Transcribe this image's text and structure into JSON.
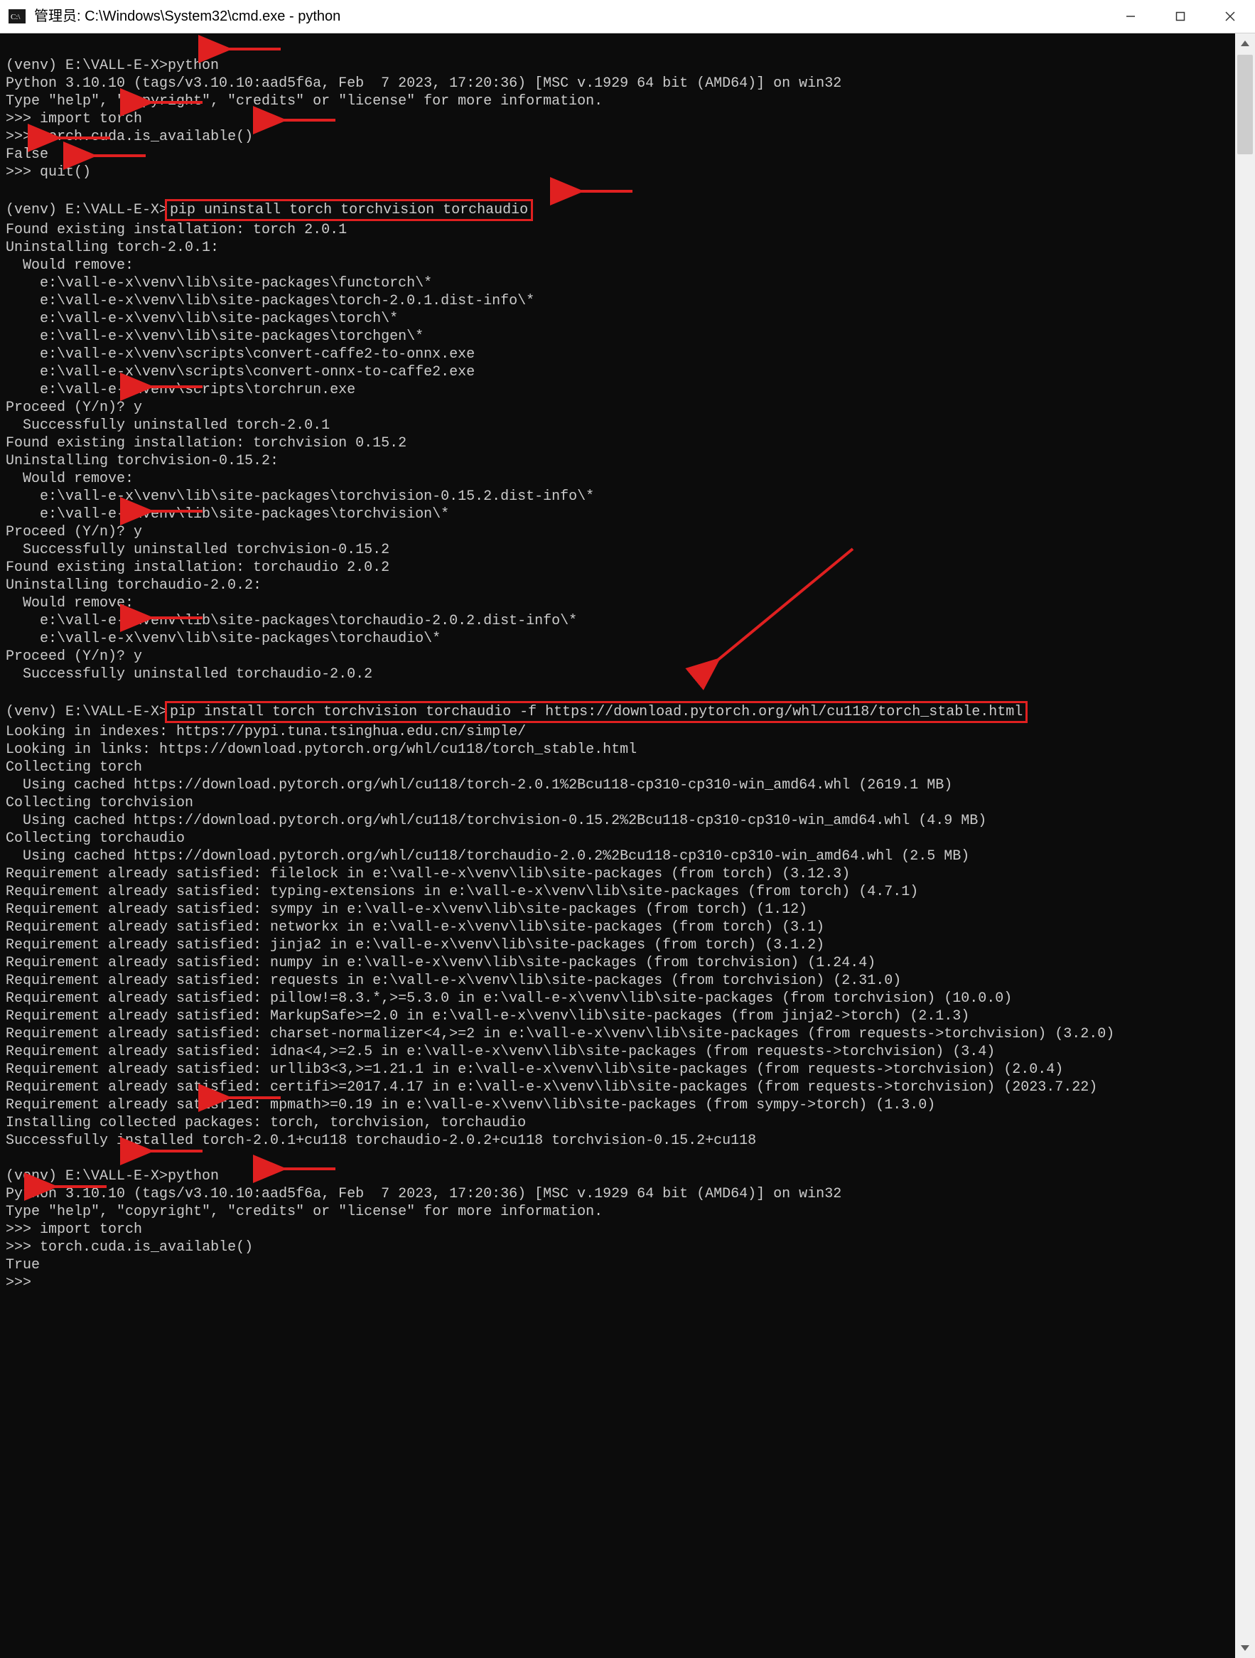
{
  "title": "管理员: C:\\Windows\\System32\\cmd.exe - python",
  "prompt": "(venv) E:\\VALL-E-X>",
  "py_prompt": ">>>",
  "cmd": {
    "python": "python",
    "import_torch": "import torch",
    "cuda_avail": "torch.cuda.is_available()",
    "quit": "quit()",
    "pip_uninstall": "pip uninstall torch torchvision torchaudio",
    "pip_install": "pip install torch torchvision torchaudio -f https://download.pytorch.org/whl/cu118/torch_stable.html"
  },
  "out": {
    "py_version": "Python 3.10.10 (tags/v3.10.10:aad5f6a, Feb  7 2023, 17:20:36) [MSC v.1929 64 bit (AMD64)] on win32",
    "py_hint": "Type \"help\", \"copyright\", \"credits\" or \"license\" for more information.",
    "false": "False",
    "true": "True",
    "found_torch": "Found existing installation: torch 2.0.1",
    "uninst_torch_hdr": "Uninstalling torch-2.0.1:",
    "would_remove": "  Would remove:",
    "rm1": "    e:\\vall-e-x\\venv\\lib\\site-packages\\functorch\\*",
    "rm2": "    e:\\vall-e-x\\venv\\lib\\site-packages\\torch-2.0.1.dist-info\\*",
    "rm3": "    e:\\vall-e-x\\venv\\lib\\site-packages\\torch\\*",
    "rm4": "    e:\\vall-e-x\\venv\\lib\\site-packages\\torchgen\\*",
    "rm5": "    e:\\vall-e-x\\venv\\scripts\\convert-caffe2-to-onnx.exe",
    "rm6": "    e:\\vall-e-x\\venv\\scripts\\convert-onnx-to-caffe2.exe",
    "rm7": "    e:\\vall-e-x\\venv\\scripts\\torchrun.exe",
    "proceed": "Proceed (Y/n)? y",
    "ok_uninst_torch": "  Successfully uninstalled torch-2.0.1",
    "found_tv": "Found existing installation: torchvision 0.15.2",
    "uninst_tv_hdr": "Uninstalling torchvision-0.15.2:",
    "rm_tv1": "    e:\\vall-e-x\\venv\\lib\\site-packages\\torchvision-0.15.2.dist-info\\*",
    "rm_tv2": "    e:\\vall-e-x\\venv\\lib\\site-packages\\torchvision\\*",
    "ok_uninst_tv": "  Successfully uninstalled torchvision-0.15.2",
    "found_ta": "Found existing installation: torchaudio 2.0.2",
    "uninst_ta_hdr": "Uninstalling torchaudio-2.0.2:",
    "rm_ta1": "    e:\\vall-e-x\\venv\\lib\\site-packages\\torchaudio-2.0.2.dist-info\\*",
    "rm_ta2": "    e:\\vall-e-x\\venv\\lib\\site-packages\\torchaudio\\*",
    "ok_uninst_ta": "  Successfully uninstalled torchaudio-2.0.2",
    "look_idx": "Looking in indexes: https://pypi.tuna.tsinghua.edu.cn/simple/",
    "look_links": "Looking in links: https://download.pytorch.org/whl/cu118/torch_stable.html",
    "coll_torch": "Collecting torch",
    "cache_torch": "  Using cached https://download.pytorch.org/whl/cu118/torch-2.0.1%2Bcu118-cp310-cp310-win_amd64.whl (2619.1 MB)",
    "coll_tv": "Collecting torchvision",
    "cache_tv": "  Using cached https://download.pytorch.org/whl/cu118/torchvision-0.15.2%2Bcu118-cp310-cp310-win_amd64.whl (4.9 MB)",
    "coll_ta": "Collecting torchaudio",
    "cache_ta": "  Using cached https://download.pytorch.org/whl/cu118/torchaudio-2.0.2%2Bcu118-cp310-cp310-win_amd64.whl (2.5 MB)",
    "req1": "Requirement already satisfied: filelock in e:\\vall-e-x\\venv\\lib\\site-packages (from torch) (3.12.3)",
    "req2": "Requirement already satisfied: typing-extensions in e:\\vall-e-x\\venv\\lib\\site-packages (from torch) (4.7.1)",
    "req3": "Requirement already satisfied: sympy in e:\\vall-e-x\\venv\\lib\\site-packages (from torch) (1.12)",
    "req4": "Requirement already satisfied: networkx in e:\\vall-e-x\\venv\\lib\\site-packages (from torch) (3.1)",
    "req5": "Requirement already satisfied: jinja2 in e:\\vall-e-x\\venv\\lib\\site-packages (from torch) (3.1.2)",
    "req6": "Requirement already satisfied: numpy in e:\\vall-e-x\\venv\\lib\\site-packages (from torchvision) (1.24.4)",
    "req7": "Requirement already satisfied: requests in e:\\vall-e-x\\venv\\lib\\site-packages (from torchvision) (2.31.0)",
    "req8": "Requirement already satisfied: pillow!=8.3.*,>=5.3.0 in e:\\vall-e-x\\venv\\lib\\site-packages (from torchvision) (10.0.0)",
    "req9": "Requirement already satisfied: MarkupSafe>=2.0 in e:\\vall-e-x\\venv\\lib\\site-packages (from jinja2->torch) (2.1.3)",
    "req10": "Requirement already satisfied: charset-normalizer<4,>=2 in e:\\vall-e-x\\venv\\lib\\site-packages (from requests->torchvision) (3.2.0)",
    "req11": "Requirement already satisfied: idna<4,>=2.5 in e:\\vall-e-x\\venv\\lib\\site-packages (from requests->torchvision) (3.4)",
    "req12": "Requirement already satisfied: urllib3<3,>=1.21.1 in e:\\vall-e-x\\venv\\lib\\site-packages (from requests->torchvision) (2.0.4)",
    "req13": "Requirement already satisfied: certifi>=2017.4.17 in e:\\vall-e-x\\venv\\lib\\site-packages (from requests->torchvision) (2023.7.22)",
    "req14": "Requirement already satisfied: mpmath>=0.19 in e:\\vall-e-x\\venv\\lib\\site-packages (from sympy->torch) (1.3.0)",
    "installing": "Installing collected packages: torch, torchvision, torchaudio",
    "installed": "Successfully installed torch-2.0.1+cu118 torchaudio-2.0.2+cu118 torchvision-0.15.2+cu118"
  }
}
